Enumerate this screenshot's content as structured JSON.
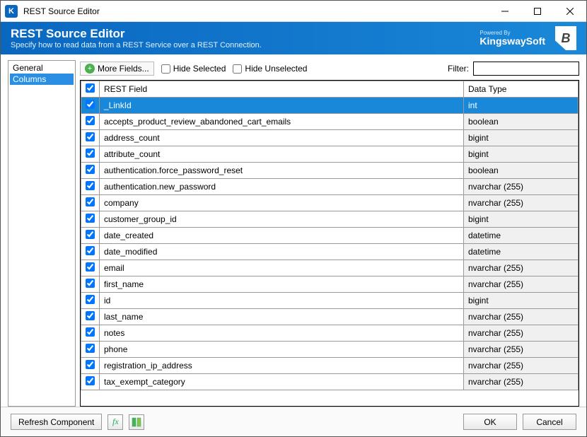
{
  "window": {
    "title": "REST Source Editor"
  },
  "banner": {
    "title": "REST Source Editor",
    "subtitle": "Specify how to read data from a REST Service over a REST Connection.",
    "powered_by": "Powered By",
    "brand": "KingswaySoft",
    "badge": "B"
  },
  "sidebar": {
    "items": [
      {
        "label": "General",
        "selected": false
      },
      {
        "label": "Columns",
        "selected": true
      }
    ]
  },
  "toolbar": {
    "more_fields": "More Fields...",
    "hide_selected": "Hide Selected",
    "hide_unselected": "Hide Unselected",
    "filter_label": "Filter:",
    "filter_value": ""
  },
  "grid": {
    "headers": {
      "field": "REST Field",
      "type": "Data Type"
    },
    "rows": [
      {
        "checked": true,
        "field": "_LinkId",
        "type": "int",
        "selected": true
      },
      {
        "checked": true,
        "field": "accepts_product_review_abandoned_cart_emails",
        "type": "boolean"
      },
      {
        "checked": true,
        "field": "address_count",
        "type": "bigint"
      },
      {
        "checked": true,
        "field": "attribute_count",
        "type": "bigint"
      },
      {
        "checked": true,
        "field": "authentication.force_password_reset",
        "type": "boolean"
      },
      {
        "checked": true,
        "field": "authentication.new_password",
        "type": "nvarchar (255)"
      },
      {
        "checked": true,
        "field": "company",
        "type": "nvarchar (255)"
      },
      {
        "checked": true,
        "field": "customer_group_id",
        "type": "bigint"
      },
      {
        "checked": true,
        "field": "date_created",
        "type": "datetime"
      },
      {
        "checked": true,
        "field": "date_modified",
        "type": "datetime"
      },
      {
        "checked": true,
        "field": "email",
        "type": "nvarchar (255)"
      },
      {
        "checked": true,
        "field": "first_name",
        "type": "nvarchar (255)"
      },
      {
        "checked": true,
        "field": "id",
        "type": "bigint"
      },
      {
        "checked": true,
        "field": "last_name",
        "type": "nvarchar (255)"
      },
      {
        "checked": true,
        "field": "notes",
        "type": "nvarchar (255)"
      },
      {
        "checked": true,
        "field": "phone",
        "type": "nvarchar (255)"
      },
      {
        "checked": true,
        "field": "registration_ip_address",
        "type": "nvarchar (255)"
      },
      {
        "checked": true,
        "field": "tax_exempt_category",
        "type": "nvarchar (255)"
      }
    ]
  },
  "footer": {
    "refresh": "Refresh Component",
    "ok": "OK",
    "cancel": "Cancel"
  }
}
